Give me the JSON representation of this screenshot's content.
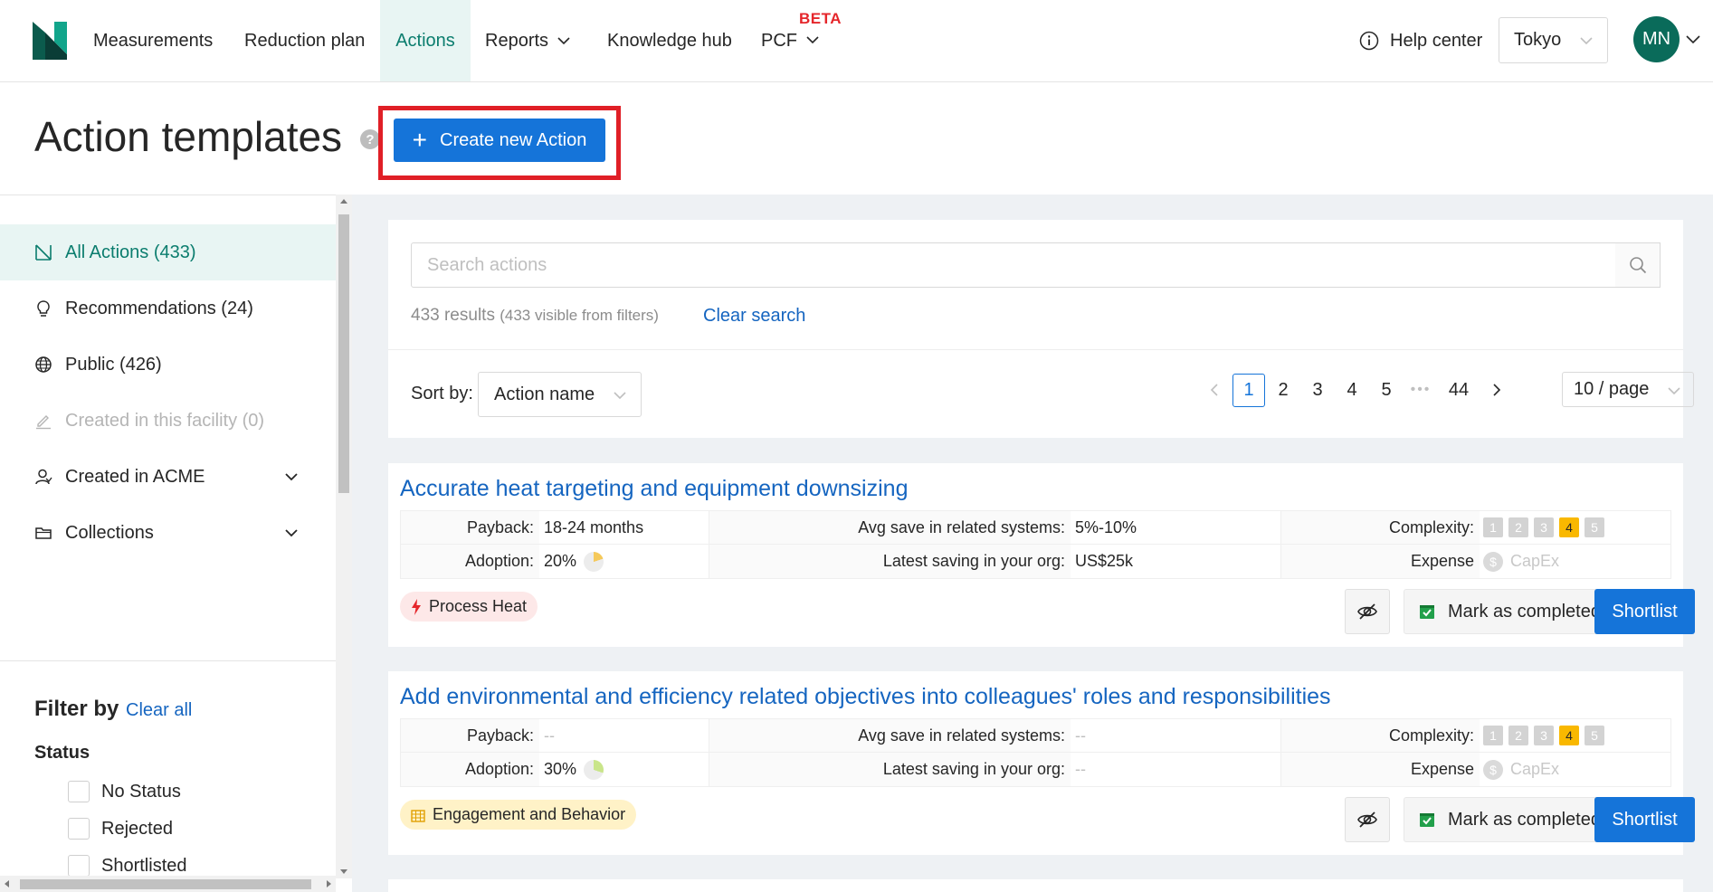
{
  "nav": {
    "items": [
      {
        "label": "Measurements"
      },
      {
        "label": "Reduction plan"
      },
      {
        "label": "Actions"
      },
      {
        "label": "Reports"
      },
      {
        "label": "Knowledge hub"
      },
      {
        "label": "PCF"
      }
    ],
    "beta_badge": "BETA",
    "help_center": "Help center",
    "facility": "Tokyo",
    "avatar_initials": "MN"
  },
  "header": {
    "title": "Action templates",
    "help_symbol": "?",
    "create_button": "Create new Action"
  },
  "sidebar": {
    "items": [
      {
        "label": "All Actions (433)"
      },
      {
        "label": "Recommendations (24)"
      },
      {
        "label": "Public (426)"
      },
      {
        "label": "Created in this facility (0)"
      },
      {
        "label": "Created in ACME"
      },
      {
        "label": "Collections"
      }
    ],
    "filter_by": "Filter by",
    "clear_all": "Clear all",
    "status_title": "Status",
    "status_options": [
      {
        "label": "No Status"
      },
      {
        "label": "Rejected"
      },
      {
        "label": "Shortlisted"
      }
    ]
  },
  "search": {
    "placeholder": "Search actions",
    "results": "433 results",
    "visible": "(433 visible from filters)",
    "clear_search": "Clear search"
  },
  "sort": {
    "label": "Sort by:",
    "value": "Action name"
  },
  "pagination": {
    "pages": [
      "1",
      "2",
      "3",
      "4",
      "5"
    ],
    "ellipsis": "•••",
    "last_page": "44",
    "current": "1",
    "page_size": "10 / page"
  },
  "labels": {
    "payback": "Payback:",
    "adoption": "Adoption:",
    "avg_save": "Avg save in related systems:",
    "latest_saving": "Latest saving in your org:",
    "complexity": "Complexity:",
    "expense": "Expense",
    "capex": "CapEx",
    "dollar": "$",
    "mark_completed": "Mark as completed",
    "shortlist": "Shortlist",
    "complexity_levels": [
      "1",
      "2",
      "3",
      "4",
      "5"
    ]
  },
  "actions": [
    {
      "title": "Accurate heat targeting and equipment downsizing",
      "payback": "18-24 months",
      "adoption": "20%",
      "adoption_fraction": 0.2,
      "avg_save": "5%-10%",
      "latest_saving": "US$25k",
      "complexity": 4,
      "tag": "Process Heat",
      "tag_color": "#fde8e8"
    },
    {
      "title": "Add environmental and efficiency related objectives into colleagues' roles and responsibilities",
      "payback": "--",
      "adoption": "30%",
      "adoption_fraction": 0.3,
      "avg_save": "--",
      "latest_saving": "--",
      "complexity": 4,
      "tag": "Engagement and Behavior",
      "tag_color": "#fff2c7"
    }
  ],
  "colors": {
    "primary": "#1574d9",
    "brand_teal": "#0b7d6e",
    "highlight_red": "#e01f26",
    "complexity_active": "#f9b800",
    "pie_fill": "#f5c95a",
    "pie_fill_2": "#c9e58a"
  }
}
